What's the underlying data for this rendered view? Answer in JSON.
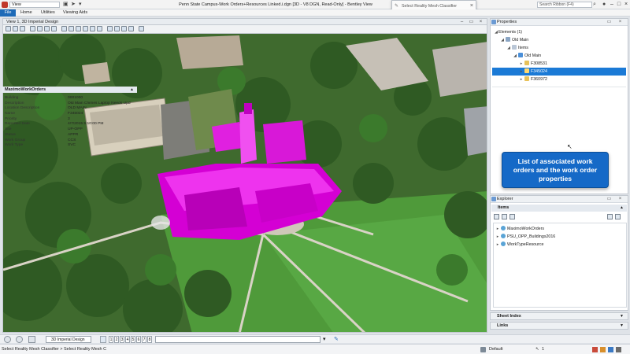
{
  "titlebar": {
    "workspace_value": "View",
    "title": "Penn State Campus-Work Orders+Resources Linked.i.dgn [3D - V8 DGN, Read-Only] - Bentley View",
    "search_placeholder": "Search Ribbon (F4)"
  },
  "floating_dialog": {
    "title": "Select Reality Mesh Classifier"
  },
  "ribbon": {
    "tabs": [
      "File",
      "Home",
      "Utilities",
      "Viewing Aids"
    ]
  },
  "view_window": {
    "title": "View 1, 3D Imperial Design"
  },
  "properties": {
    "title": "Properties",
    "tree": [
      {
        "label": "Elements (1)",
        "level": 0,
        "expanded": true
      },
      {
        "label": "Old Main",
        "level": 1,
        "expanded": true
      },
      {
        "label": "Items",
        "level": 2,
        "expanded": true
      },
      {
        "label": "Old Main",
        "level": 3,
        "expanded": true
      },
      {
        "label": "F308531",
        "level": 4,
        "expanded": false
      },
      {
        "label": "F345024",
        "level": 4,
        "expanded": false,
        "selected": true
      },
      {
        "label": "F360972",
        "level": 4,
        "expanded": false
      }
    ],
    "section_title": "MaximoWorkOrders",
    "rows": [
      {
        "key": "Building",
        "value": "0001000"
      },
      {
        "key": "Description",
        "value": "Old Main Chimes Laptop Needs Upd"
      },
      {
        "key": "Location Description",
        "value": "OLD MAIN"
      },
      {
        "key": "Name",
        "value": "F345024"
      },
      {
        "key": "Priority",
        "value": "3"
      },
      {
        "key": "Reported Date",
        "value": "4/7/2015 5:10:00 PM"
      },
      {
        "key": "Site",
        "value": "UP-OPP"
      },
      {
        "key": "Status",
        "value": "APPR"
      },
      {
        "key": "Work Group",
        "value": "CCS"
      },
      {
        "key": "Work Type",
        "value": "SVC"
      }
    ]
  },
  "callout": {
    "line1": "List of associated work",
    "line2": "orders and the work order",
    "line3": "properties"
  },
  "explorer": {
    "title": "Explorer",
    "section": "Items",
    "items": [
      "MaximoWorkOrders",
      "PSU_OPP_Buildings2016",
      "WorkTypeResource"
    ]
  },
  "side_sections": {
    "sheet_index": "Sheet Index",
    "links": "Links"
  },
  "bottom_toolbar": {
    "view_name": "3D Imperial Design",
    "view_numbers": [
      "1",
      "2",
      "3",
      "4",
      "5",
      "6",
      "7",
      "8"
    ]
  },
  "status": {
    "prompt": "Select Reality Mesh Classifier > Select Reality Mesh C",
    "level": "Default",
    "snap_count": "1"
  },
  "colors": {
    "accent": "#1e6bb8",
    "highlight": "#e600e6",
    "callout": "#1569c7"
  }
}
